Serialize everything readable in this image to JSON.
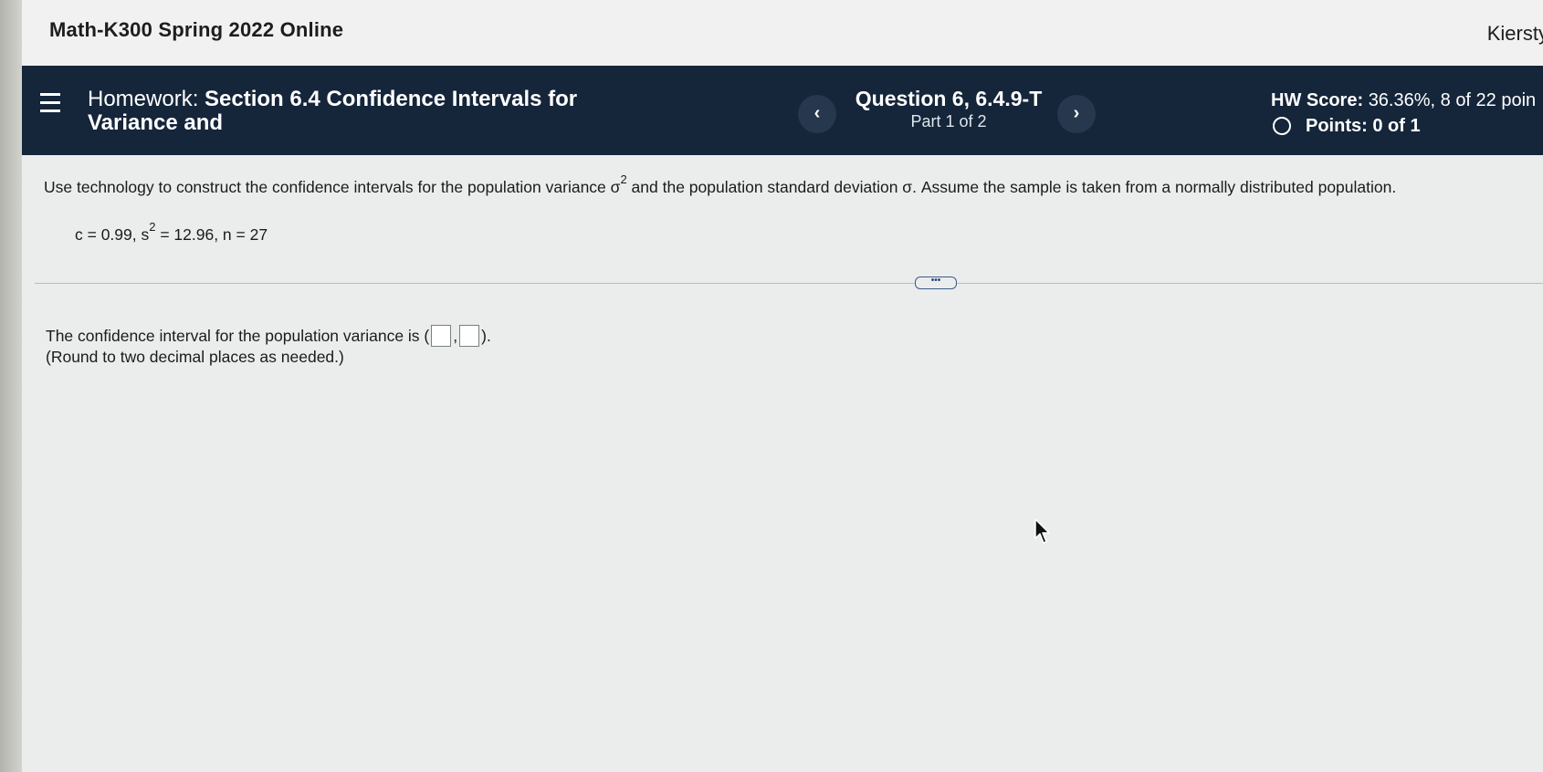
{
  "course_bar": {
    "title": "Math-K300 Spring 2022 Online",
    "user": "Kiersty"
  },
  "header": {
    "homework_prefix": "Homework:",
    "homework_title": "Section 6.4 Confidence Intervals for Variance and",
    "prev_label": "‹",
    "next_label": "›",
    "question_title": "Question 6, 6.4.9-T",
    "question_part": "Part 1 of 2",
    "hw_score_label": "HW Score:",
    "hw_score_value": "36.36%, 8 of 22 poin",
    "points": "Points: 0 of 1"
  },
  "question": {
    "prompt_start": "Use technology to construct the confidence intervals for the population variance σ",
    "prompt_sup": "2",
    "prompt_end": " and the population standard deviation σ. Assume the sample is taken from a normally distributed population.",
    "given_start": "c = 0.99, s",
    "given_sup": "2",
    "given_end": " = 12.96, n = 27",
    "expand_label": "•••",
    "answer_start": "The confidence interval for the population variance is (",
    "answer_sep": ",",
    "answer_end": ").",
    "round_note": "(Round to two decimal places as needed.)"
  },
  "icons": {
    "menu": "hamburger-menu-icon",
    "points_status": "empty-circle-icon",
    "cursor": "mouse-pointer-icon"
  }
}
